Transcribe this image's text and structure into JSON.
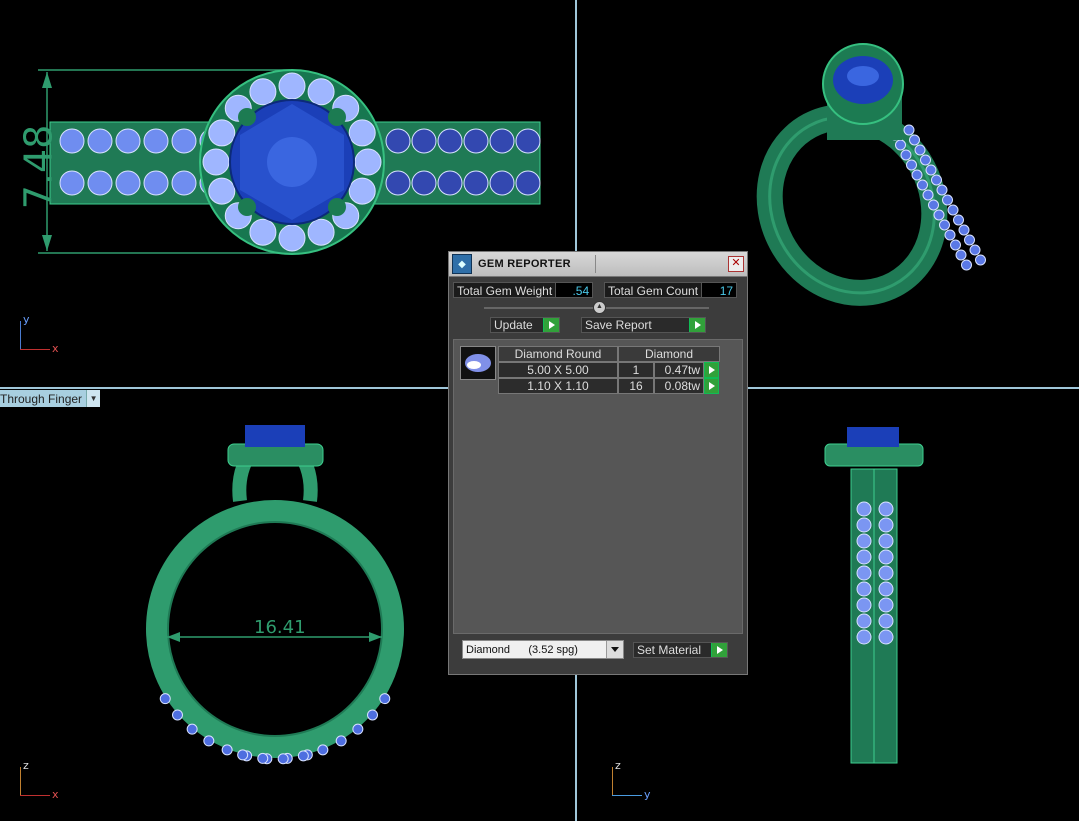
{
  "viewports": {
    "top": {
      "dimension_label": "7.48",
      "axes": {
        "vertical": "y",
        "horizontal": "x"
      }
    },
    "perspective": {},
    "front": {
      "view_label": "Through Finger",
      "dimension_label": "16.41",
      "axes": {
        "vertical": "z",
        "horizontal": "x"
      }
    },
    "side": {
      "axes": {
        "vertical": "z",
        "horizontal": "y"
      }
    }
  },
  "gem_reporter": {
    "title": "GEM REPORTER",
    "close_icon": "✕",
    "total_weight_label": "Total Gem Weight",
    "total_weight_value": ".54",
    "total_count_label": "Total Gem Count",
    "total_count_value": "17",
    "update_label": "Update",
    "save_report_label": "Save Report",
    "table": {
      "headers": [
        "Diamond Round",
        "Diamond"
      ],
      "rows": [
        {
          "size": "5.00 X 5.00",
          "count": "1",
          "weight": "0.47tw"
        },
        {
          "size": "1.10 X 1.10",
          "count": "16",
          "weight": "0.08tw"
        }
      ]
    },
    "material_select": "Diamond      (3.52 spg)",
    "set_material_label": "Set Material"
  },
  "colors": {
    "metal": "#2f9c6e",
    "center_stone": "#1b3fb8",
    "accent_stones": "#8fa8ff",
    "dimension": "#2f9c6e"
  }
}
